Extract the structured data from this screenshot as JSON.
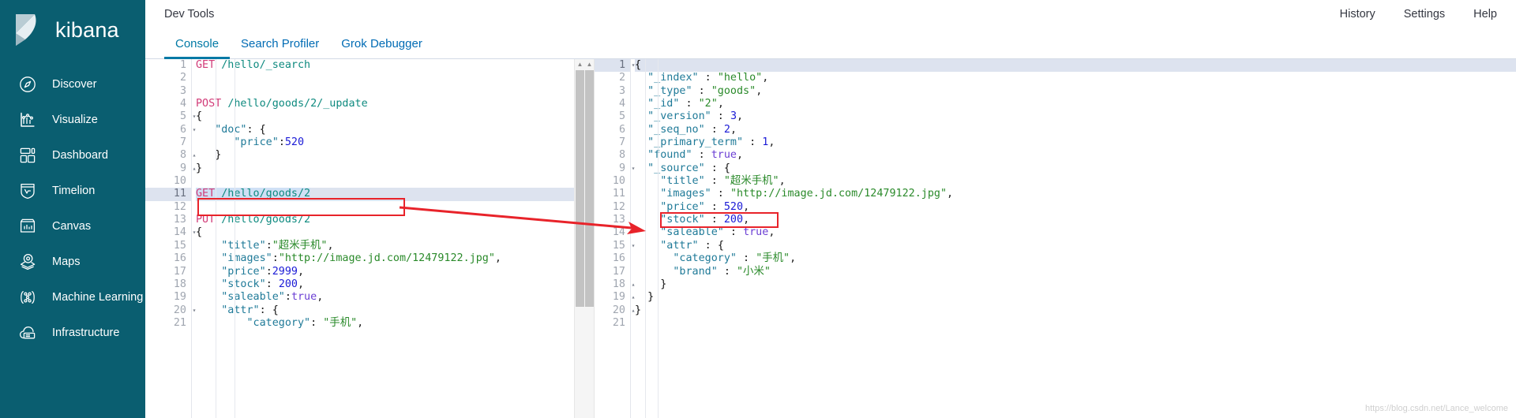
{
  "brand": {
    "name": "kibana",
    "logo_icon": "kibana-logo-icon"
  },
  "sidebar": {
    "items": [
      {
        "label": "Discover",
        "icon": "compass-icon"
      },
      {
        "label": "Visualize",
        "icon": "bar-chart-icon"
      },
      {
        "label": "Dashboard",
        "icon": "dashboard-grid-icon"
      },
      {
        "label": "Timelion",
        "icon": "timelion-shield-icon"
      },
      {
        "label": "Canvas",
        "icon": "canvas-frame-icon"
      },
      {
        "label": "Maps",
        "icon": "map-marker-layers-icon"
      },
      {
        "label": "Machine Learning",
        "icon": "machine-learning-nodes-icon"
      },
      {
        "label": "Infrastructure",
        "icon": "infrastructure-cloud-icon"
      }
    ]
  },
  "topbar": {
    "title": "Dev Tools",
    "links": [
      {
        "label": "History"
      },
      {
        "label": "Settings"
      },
      {
        "label": "Help"
      }
    ]
  },
  "tabs": [
    {
      "label": "Console",
      "active": true
    },
    {
      "label": "Search Profiler",
      "active": false
    },
    {
      "label": "Grok Debugger",
      "active": false
    }
  ],
  "request_editor": {
    "highlighted_line": 11,
    "lines": [
      {
        "n": 1,
        "fold": "",
        "tokens": [
          {
            "t": "GET",
            "c": "t-method"
          },
          {
            "t": " ",
            "c": "t-punct"
          },
          {
            "t": "/hello/_search",
            "c": "t-url"
          }
        ]
      },
      {
        "n": 2,
        "fold": "",
        "tokens": []
      },
      {
        "n": 3,
        "fold": "",
        "tokens": []
      },
      {
        "n": 4,
        "fold": "",
        "tokens": [
          {
            "t": "POST",
            "c": "t-method"
          },
          {
            "t": " ",
            "c": "t-punct"
          },
          {
            "t": "/hello/goods/2/_update",
            "c": "t-url"
          }
        ]
      },
      {
        "n": 5,
        "fold": "▾",
        "tokens": [
          {
            "t": "{",
            "c": "t-brace"
          }
        ]
      },
      {
        "n": 6,
        "fold": "▾",
        "tokens": [
          {
            "t": "   ",
            "c": "t-punct"
          },
          {
            "t": "\"doc\"",
            "c": "t-key"
          },
          {
            "t": ": ",
            "c": "t-punct"
          },
          {
            "t": "{",
            "c": "t-brace"
          }
        ]
      },
      {
        "n": 7,
        "fold": "",
        "tokens": [
          {
            "t": "      ",
            "c": "t-punct"
          },
          {
            "t": "\"price\"",
            "c": "t-key"
          },
          {
            "t": ":",
            "c": "t-punct"
          },
          {
            "t": "520",
            "c": "t-num"
          }
        ]
      },
      {
        "n": 8,
        "fold": "▴",
        "tokens": [
          {
            "t": "   ",
            "c": "t-punct"
          },
          {
            "t": "}",
            "c": "t-brace"
          }
        ]
      },
      {
        "n": 9,
        "fold": "▴",
        "tokens": [
          {
            "t": "}",
            "c": "t-brace"
          }
        ]
      },
      {
        "n": 10,
        "fold": "",
        "tokens": []
      },
      {
        "n": 11,
        "fold": "",
        "tokens": [
          {
            "t": "GET",
            "c": "t-method sel"
          },
          {
            "t": " ",
            "c": "t-punct sel"
          },
          {
            "t": "/hello/goods/2",
            "c": "t-url sel"
          }
        ]
      },
      {
        "n": 12,
        "fold": "",
        "tokens": []
      },
      {
        "n": 13,
        "fold": "",
        "tokens": [
          {
            "t": "PUT",
            "c": "t-method"
          },
          {
            "t": " ",
            "c": "t-punct"
          },
          {
            "t": "/hello/goods/2",
            "c": "t-url"
          }
        ]
      },
      {
        "n": 14,
        "fold": "▾",
        "tokens": [
          {
            "t": "{",
            "c": "t-brace"
          }
        ]
      },
      {
        "n": 15,
        "fold": "",
        "tokens": [
          {
            "t": "    ",
            "c": "t-punct"
          },
          {
            "t": "\"title\"",
            "c": "t-key"
          },
          {
            "t": ":",
            "c": "t-punct"
          },
          {
            "t": "\"超米手机\"",
            "c": "t-str"
          },
          {
            "t": ",",
            "c": "t-punct"
          }
        ]
      },
      {
        "n": 16,
        "fold": "",
        "tokens": [
          {
            "t": "    ",
            "c": "t-punct"
          },
          {
            "t": "\"images\"",
            "c": "t-key"
          },
          {
            "t": ":",
            "c": "t-punct"
          },
          {
            "t": "\"http://image.jd.com/12479122.jpg\"",
            "c": "t-str"
          },
          {
            "t": ",",
            "c": "t-punct"
          }
        ]
      },
      {
        "n": 17,
        "fold": "",
        "tokens": [
          {
            "t": "    ",
            "c": "t-punct"
          },
          {
            "t": "\"price\"",
            "c": "t-key"
          },
          {
            "t": ":",
            "c": "t-punct"
          },
          {
            "t": "2999",
            "c": "t-num"
          },
          {
            "t": ",",
            "c": "t-punct"
          }
        ]
      },
      {
        "n": 18,
        "fold": "",
        "tokens": [
          {
            "t": "    ",
            "c": "t-punct"
          },
          {
            "t": "\"stock\"",
            "c": "t-key"
          },
          {
            "t": ": ",
            "c": "t-punct"
          },
          {
            "t": "200",
            "c": "t-num"
          },
          {
            "t": ",",
            "c": "t-punct"
          }
        ]
      },
      {
        "n": 19,
        "fold": "",
        "tokens": [
          {
            "t": "    ",
            "c": "t-punct"
          },
          {
            "t": "\"saleable\"",
            "c": "t-key"
          },
          {
            "t": ":",
            "c": "t-punct"
          },
          {
            "t": "true",
            "c": "t-bool"
          },
          {
            "t": ",",
            "c": "t-punct"
          }
        ]
      },
      {
        "n": 20,
        "fold": "▾",
        "tokens": [
          {
            "t": "    ",
            "c": "t-punct"
          },
          {
            "t": "\"attr\"",
            "c": "t-key"
          },
          {
            "t": ": ",
            "c": "t-punct"
          },
          {
            "t": "{",
            "c": "t-brace"
          }
        ]
      },
      {
        "n": 21,
        "fold": "",
        "tokens": [
          {
            "t": "        ",
            "c": "t-punct"
          },
          {
            "t": "\"category\"",
            "c": "t-key"
          },
          {
            "t": ": ",
            "c": "t-punct"
          },
          {
            "t": "\"手机\"",
            "c": "t-str"
          },
          {
            "t": ",",
            "c": "t-punct"
          }
        ]
      }
    ]
  },
  "response_editor": {
    "highlighted_line": 1,
    "lines": [
      {
        "n": 1,
        "fold": "▾",
        "tokens": [
          {
            "t": "{",
            "c": "t-brace"
          }
        ]
      },
      {
        "n": 2,
        "fold": "",
        "tokens": [
          {
            "t": "  ",
            "c": "t-punct"
          },
          {
            "t": "\"_index\"",
            "c": "t-key"
          },
          {
            "t": " : ",
            "c": "t-punct"
          },
          {
            "t": "\"hello\"",
            "c": "t-str"
          },
          {
            "t": ",",
            "c": "t-punct"
          }
        ]
      },
      {
        "n": 3,
        "fold": "",
        "tokens": [
          {
            "t": "  ",
            "c": "t-punct"
          },
          {
            "t": "\"_type\"",
            "c": "t-key"
          },
          {
            "t": " : ",
            "c": "t-punct"
          },
          {
            "t": "\"goods\"",
            "c": "t-str"
          },
          {
            "t": ",",
            "c": "t-punct"
          }
        ]
      },
      {
        "n": 4,
        "fold": "",
        "tokens": [
          {
            "t": "  ",
            "c": "t-punct"
          },
          {
            "t": "\"_id\"",
            "c": "t-key"
          },
          {
            "t": " : ",
            "c": "t-punct"
          },
          {
            "t": "\"2\"",
            "c": "t-str"
          },
          {
            "t": ",",
            "c": "t-punct"
          }
        ]
      },
      {
        "n": 5,
        "fold": "",
        "tokens": [
          {
            "t": "  ",
            "c": "t-punct"
          },
          {
            "t": "\"_version\"",
            "c": "t-key"
          },
          {
            "t": " : ",
            "c": "t-punct"
          },
          {
            "t": "3",
            "c": "t-num"
          },
          {
            "t": ",",
            "c": "t-punct"
          }
        ]
      },
      {
        "n": 6,
        "fold": "",
        "tokens": [
          {
            "t": "  ",
            "c": "t-punct"
          },
          {
            "t": "\"_seq_no\"",
            "c": "t-key"
          },
          {
            "t": " : ",
            "c": "t-punct"
          },
          {
            "t": "2",
            "c": "t-num"
          },
          {
            "t": ",",
            "c": "t-punct"
          }
        ]
      },
      {
        "n": 7,
        "fold": "",
        "tokens": [
          {
            "t": "  ",
            "c": "t-punct"
          },
          {
            "t": "\"_primary_term\"",
            "c": "t-key"
          },
          {
            "t": " : ",
            "c": "t-punct"
          },
          {
            "t": "1",
            "c": "t-num"
          },
          {
            "t": ",",
            "c": "t-punct"
          }
        ]
      },
      {
        "n": 8,
        "fold": "",
        "tokens": [
          {
            "t": "  ",
            "c": "t-punct"
          },
          {
            "t": "\"found\"",
            "c": "t-key"
          },
          {
            "t": " : ",
            "c": "t-punct"
          },
          {
            "t": "true",
            "c": "t-bool"
          },
          {
            "t": ",",
            "c": "t-punct"
          }
        ]
      },
      {
        "n": 9,
        "fold": "▾",
        "tokens": [
          {
            "t": "  ",
            "c": "t-punct"
          },
          {
            "t": "\"_source\"",
            "c": "t-key"
          },
          {
            "t": " : ",
            "c": "t-punct"
          },
          {
            "t": "{",
            "c": "t-brace"
          }
        ]
      },
      {
        "n": 10,
        "fold": "",
        "tokens": [
          {
            "t": "    ",
            "c": "t-punct"
          },
          {
            "t": "\"title\"",
            "c": "t-key"
          },
          {
            "t": " : ",
            "c": "t-punct"
          },
          {
            "t": "\"超米手机\"",
            "c": "t-str"
          },
          {
            "t": ",",
            "c": "t-punct"
          }
        ]
      },
      {
        "n": 11,
        "fold": "",
        "tokens": [
          {
            "t": "    ",
            "c": "t-punct"
          },
          {
            "t": "\"images\"",
            "c": "t-key"
          },
          {
            "t": " : ",
            "c": "t-punct"
          },
          {
            "t": "\"http://image.jd.com/12479122.jpg\"",
            "c": "t-str"
          },
          {
            "t": ",",
            "c": "t-punct"
          }
        ]
      },
      {
        "n": 12,
        "fold": "",
        "tokens": [
          {
            "t": "    ",
            "c": "t-punct"
          },
          {
            "t": "\"price\"",
            "c": "t-key"
          },
          {
            "t": " : ",
            "c": "t-punct"
          },
          {
            "t": "520",
            "c": "t-num"
          },
          {
            "t": ",",
            "c": "t-punct"
          }
        ]
      },
      {
        "n": 13,
        "fold": "",
        "tokens": [
          {
            "t": "    ",
            "c": "t-punct"
          },
          {
            "t": "\"stock\"",
            "c": "t-key"
          },
          {
            "t": " : ",
            "c": "t-punct"
          },
          {
            "t": "200",
            "c": "t-num"
          },
          {
            "t": ",",
            "c": "t-punct"
          }
        ]
      },
      {
        "n": 14,
        "fold": "",
        "tokens": [
          {
            "t": "    ",
            "c": "t-punct"
          },
          {
            "t": "\"saleable\"",
            "c": "t-key"
          },
          {
            "t": " : ",
            "c": "t-punct"
          },
          {
            "t": "true",
            "c": "t-bool"
          },
          {
            "t": ",",
            "c": "t-punct"
          }
        ]
      },
      {
        "n": 15,
        "fold": "▾",
        "tokens": [
          {
            "t": "    ",
            "c": "t-punct"
          },
          {
            "t": "\"attr\"",
            "c": "t-key"
          },
          {
            "t": " : ",
            "c": "t-punct"
          },
          {
            "t": "{",
            "c": "t-brace"
          }
        ]
      },
      {
        "n": 16,
        "fold": "",
        "tokens": [
          {
            "t": "      ",
            "c": "t-punct"
          },
          {
            "t": "\"category\"",
            "c": "t-key"
          },
          {
            "t": " : ",
            "c": "t-punct"
          },
          {
            "t": "\"手机\"",
            "c": "t-str"
          },
          {
            "t": ",",
            "c": "t-punct"
          }
        ]
      },
      {
        "n": 17,
        "fold": "",
        "tokens": [
          {
            "t": "      ",
            "c": "t-punct"
          },
          {
            "t": "\"brand\"",
            "c": "t-key"
          },
          {
            "t": " : ",
            "c": "t-punct"
          },
          {
            "t": "\"小米\"",
            "c": "t-str"
          }
        ]
      },
      {
        "n": 18,
        "fold": "▴",
        "tokens": [
          {
            "t": "    ",
            "c": "t-punct"
          },
          {
            "t": "}",
            "c": "t-brace"
          }
        ]
      },
      {
        "n": 19,
        "fold": "▴",
        "tokens": [
          {
            "t": "  ",
            "c": "t-punct"
          },
          {
            "t": "}",
            "c": "t-brace"
          }
        ]
      },
      {
        "n": 20,
        "fold": "▴",
        "tokens": [
          {
            "t": "}",
            "c": "t-brace"
          }
        ]
      },
      {
        "n": 21,
        "fold": "",
        "tokens": []
      }
    ]
  },
  "run_controls": {
    "play_label": "send-request",
    "wrench_label": "request-options"
  },
  "annotations": {
    "box_color": "#e8232a",
    "arrow_color": "#e8232a"
  },
  "watermark": {
    "text": "https://blog.csdn.net/Lance_welcome"
  },
  "colors": {
    "sidebar_bg": "#0a5e70",
    "tab_active": "#0079a5",
    "link": "#006bb4",
    "annotation": "#e8232a"
  }
}
